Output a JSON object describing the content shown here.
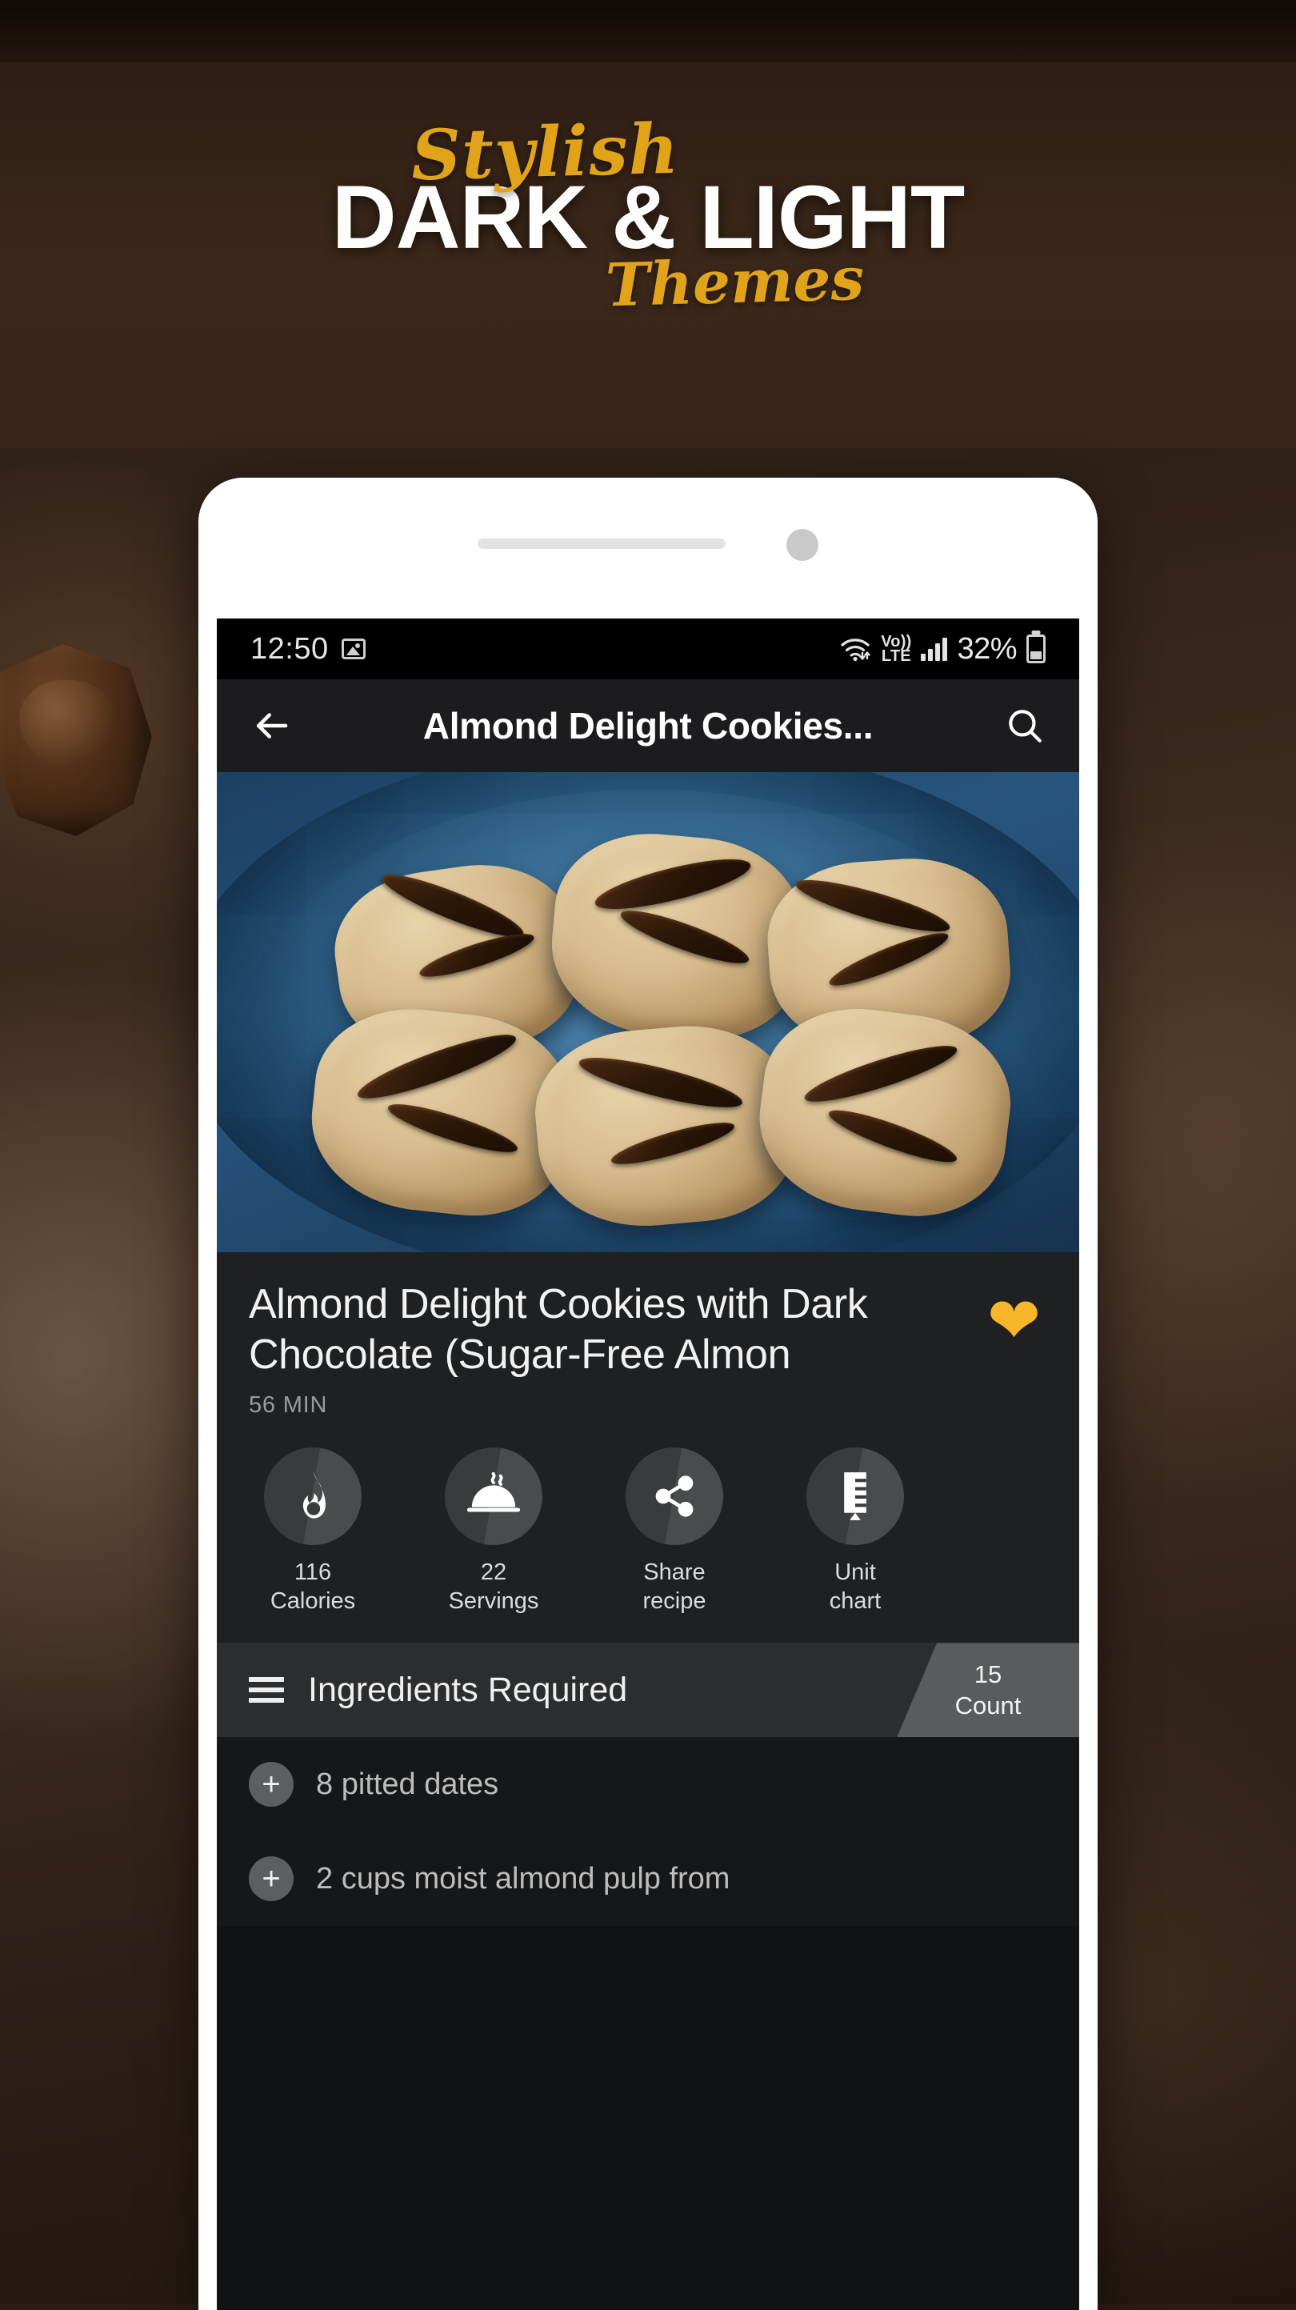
{
  "banner": {
    "script_top": "Stylish",
    "headline": "DARK & LIGHT",
    "script_bottom": "Themes",
    "gold": "#e0a319",
    "white": "#fdfdfb"
  },
  "statusbar": {
    "time": "12:50",
    "image_icon": "image-icon",
    "wifi_icon": "wifi-icon",
    "volte_line1": "Vo))",
    "volte_line2": "LTE",
    "signal_icon": "signal-bars-icon",
    "battery_percent": "32%",
    "battery_icon": "battery-icon"
  },
  "appbar": {
    "back_icon": "back-arrow-icon",
    "title": "Almond Delight Cookies...",
    "search_icon": "search-icon"
  },
  "recipe": {
    "title": "Almond Delight Cookies with Dark Chocolate (Sugar-Free Almon",
    "duration": "56 MIN",
    "favorite_icon": "heart-icon",
    "favorite_color": "#f8b62b"
  },
  "actions": [
    {
      "icon": "flame-icon",
      "value": "116",
      "label": "Calories"
    },
    {
      "icon": "serving-dome-icon",
      "value": "22",
      "label": "Servings"
    },
    {
      "icon": "share-icon",
      "value": "Share",
      "label": "recipe"
    },
    {
      "icon": "unit-chart-icon",
      "value": "Unit",
      "label": "chart"
    }
  ],
  "ingredients_section": {
    "list_icon": "list-icon",
    "title": "Ingredients Required",
    "count_value": "15",
    "count_label": "Count",
    "items": [
      {
        "add_icon": "plus-icon",
        "text": "8 pitted dates"
      },
      {
        "add_icon": "plus-icon",
        "text": "2 cups moist almond pulp from"
      }
    ]
  }
}
